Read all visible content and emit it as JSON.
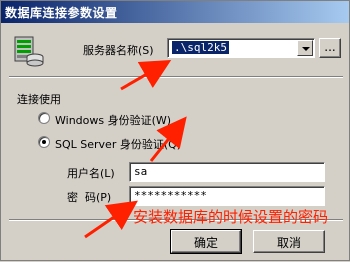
{
  "window": {
    "title": "数据库连接参数设置"
  },
  "server": {
    "label": "服务器名称(S)",
    "value": ".\\sql2k5",
    "browse_label": "..."
  },
  "connection": {
    "group_label": "连接使用",
    "windows_auth_label": "Windows 身份验证(W)",
    "sql_auth_label": "SQL Server 身份验证(Q)",
    "selected": "sql"
  },
  "credentials": {
    "username_label": "用户名(L)",
    "username_value": "sa",
    "password_label": "密  码(P)",
    "password_value": "***********"
  },
  "annotation": {
    "text": "安装数据库的时候设置的密码",
    "color": "#ff2000"
  },
  "buttons": {
    "ok_label": "确定",
    "cancel_label": "取消"
  }
}
